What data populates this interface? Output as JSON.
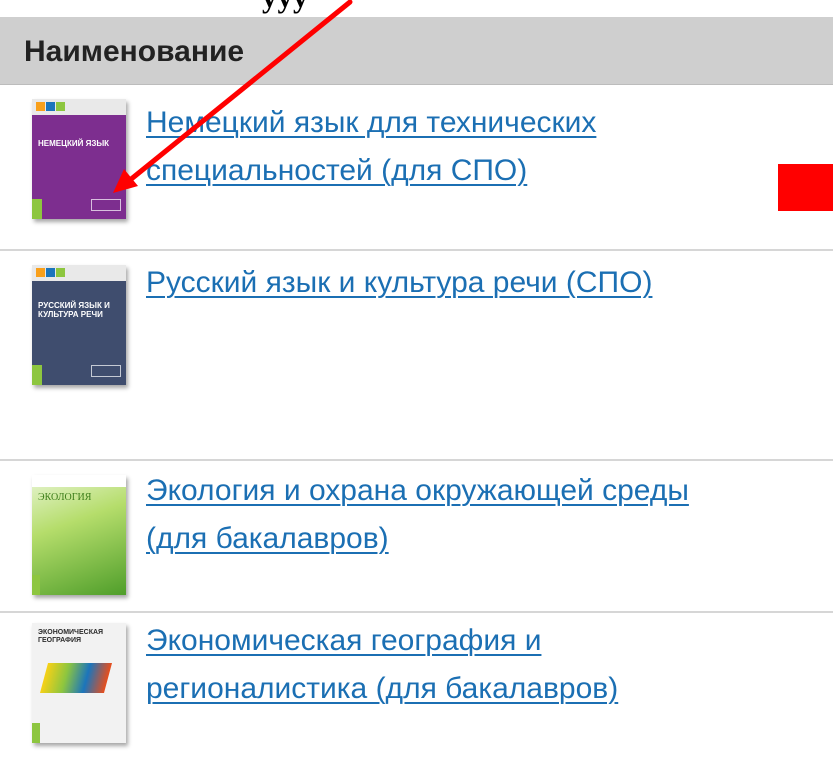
{
  "top_strip": {
    "text": "ууу"
  },
  "header": {
    "column_title": "Наименование"
  },
  "books": [
    {
      "title_lines": [
        "Немецкий язык для технических",
        "специальностей (для СПО)"
      ],
      "cover": {
        "title": "НЕМЕЦКИЙ ЯЗЫК",
        "color": "#7d2e8f"
      }
    },
    {
      "title_lines": [
        "Русский язык и культура речи (СПО)",
        ""
      ],
      "cover": {
        "title": "РУССКИЙ ЯЗЫК И КУЛЬТУРА РЕЧИ",
        "color": "#3f4d6e"
      }
    },
    {
      "title_lines": [
        "Экология и охрана окружающей среды",
        "(для бакалавров)"
      ],
      "cover": {
        "title": "ЭКОЛОГИЯ",
        "color": "#8dc63f"
      }
    },
    {
      "title_lines": [
        "Экономическая география и",
        "регионалистика (для бакалавров)"
      ],
      "cover": {
        "title": "ЭКОНОМИЧЕСКАЯ ГЕОГРАФИЯ",
        "color": "#f2f2f2"
      }
    }
  ],
  "colors": {
    "link": "#1b6fb3",
    "header_bg": "#cfcfcf",
    "annotation": "#ff0000"
  }
}
